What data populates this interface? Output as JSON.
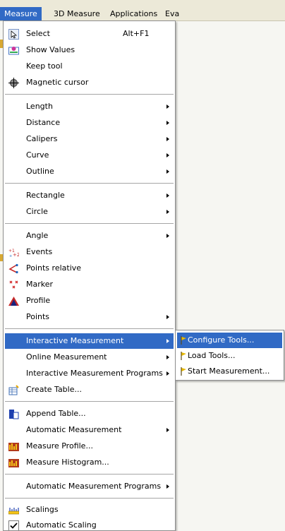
{
  "menubar": {
    "items": [
      "Measure",
      "3D Measure",
      "Applications",
      "Eva"
    ]
  },
  "menu": {
    "select": {
      "label": "Select",
      "shortcut": "Alt+F1"
    },
    "show_values": "Show Values",
    "keep_tool": "Keep tool",
    "magnetic_cursor": "Magnetic cursor",
    "length": "Length",
    "distance": "Distance",
    "calipers": "Calipers",
    "curve": "Curve",
    "outline": "Outline",
    "rectangle": "Rectangle",
    "circle": "Circle",
    "angle": "Angle",
    "events": "Events",
    "points_relative": "Points relative",
    "marker": "Marker",
    "profile": "Profile",
    "points": "Points",
    "interactive_measurement": "Interactive Measurement",
    "online_measurement": "Online Measurement",
    "interactive_measurement_programs": "Interactive Measurement Programs",
    "create_table": "Create Table...",
    "append_table": "Append Table...",
    "automatic_measurement": "Automatic Measurement",
    "measure_profile": "Measure Profile...",
    "measure_histogram": "Measure Histogram...",
    "automatic_measurement_programs": "Automatic Measurement Programs",
    "scalings": "Scalings",
    "automatic_scaling": "Automatic Scaling"
  },
  "submenu": {
    "configure_tools": "Configure Tools...",
    "load_tools": "Load Tools...",
    "start_measurement": "Start Measurement..."
  },
  "colors": {
    "highlight": "#316ac5",
    "menubar_bg": "#ece9d8"
  }
}
